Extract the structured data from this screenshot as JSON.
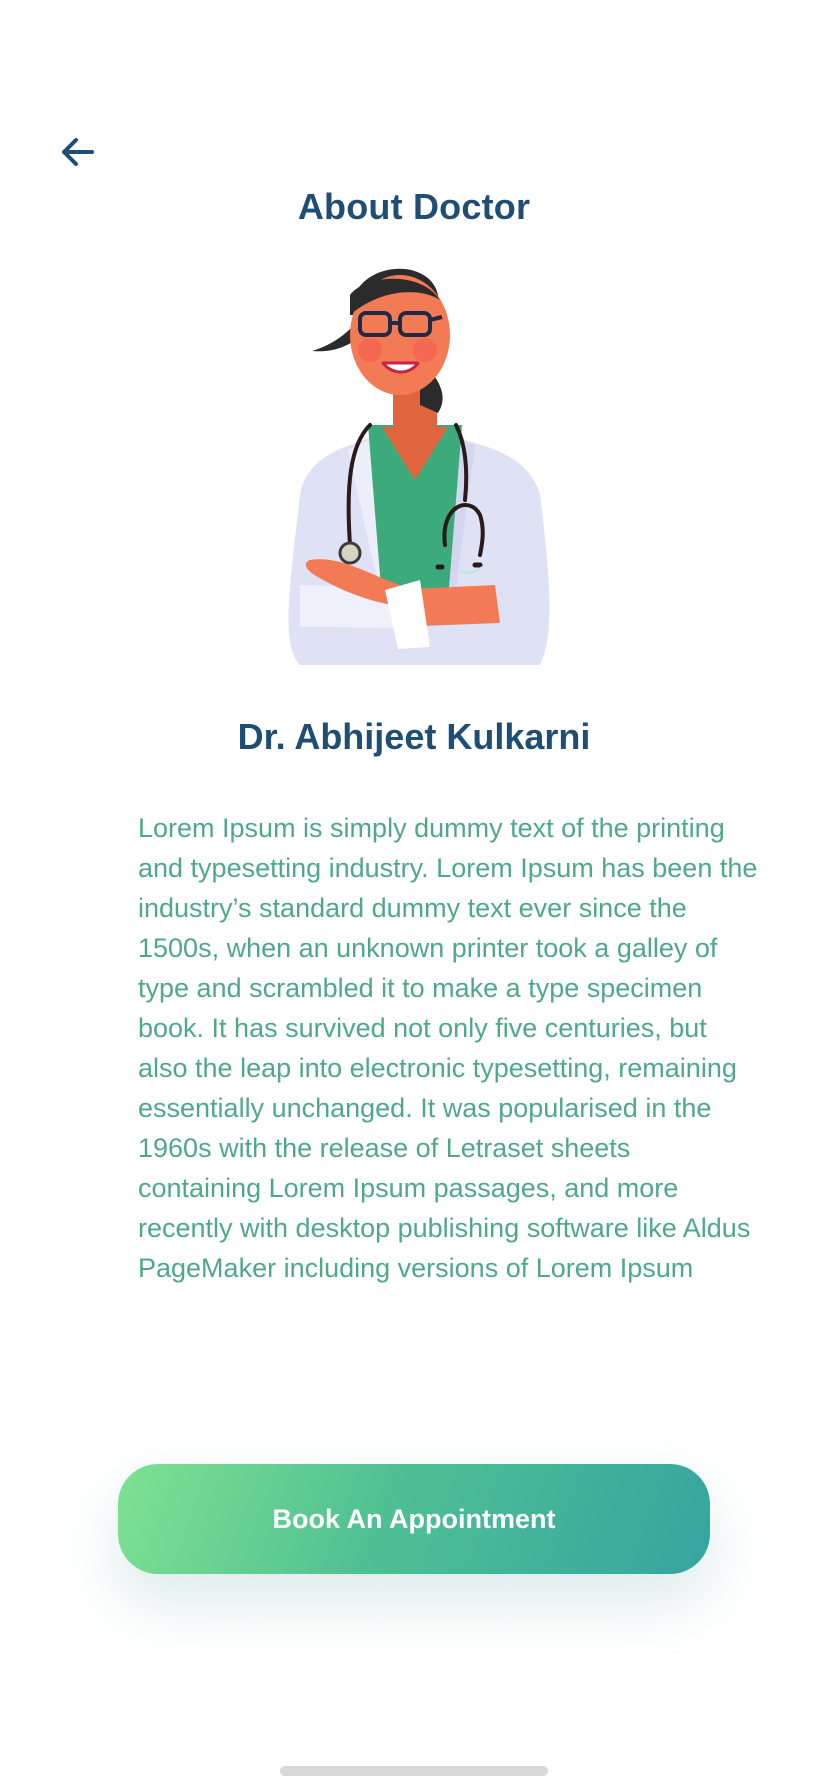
{
  "header": {
    "back_icon": "arrow-left-icon",
    "title": "About Doctor"
  },
  "doctor": {
    "name": "Dr. Abhijeet Kulkarni",
    "illustration": "doctor-avatar-illustration",
    "bio": "Lorem Ipsum is simply dummy text of the printing and typesetting industry. Lorem Ipsum has been the industry’s standard dummy text ever since the 1500s, when an unknown printer took a galley of type and scrambled it to make a type specimen book. It has survived not only five centuries, but also the leap into electronic typesetting, remaining essentially unchanged. It was popularised in the 1960s with the release of Letraset sheets containing Lorem Ipsum passages, and more recently with desktop publishing software like Aldus PageMaker including versions of Lorem Ipsum"
  },
  "actions": {
    "book_label": "Book An Appointment"
  },
  "colors": {
    "primary_text": "#1f4e74",
    "body_text": "#4fa88c",
    "button_gradient_start": "#7ee292",
    "button_gradient_end": "#35a5a0"
  }
}
